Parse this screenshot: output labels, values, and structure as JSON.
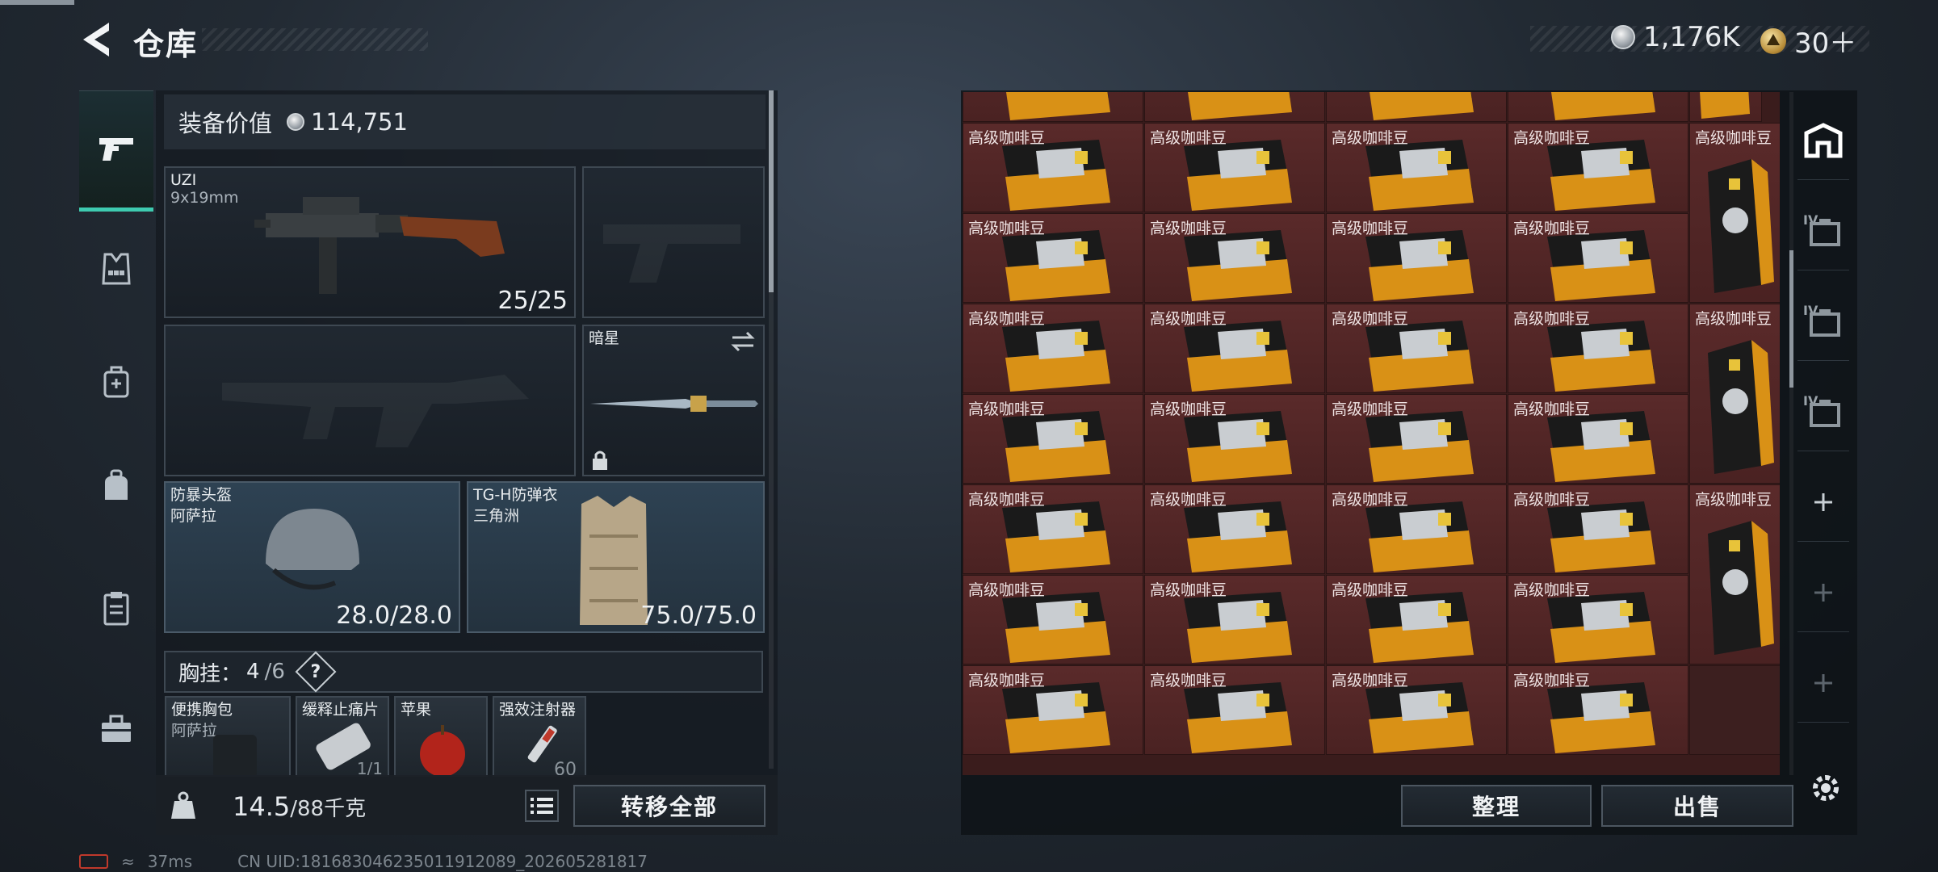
{
  "header": {
    "title": "仓库",
    "currency_silver": "1,176K",
    "currency_gold": "30＋"
  },
  "left_nav": {
    "items": [
      "weapons-icon",
      "armor-icon",
      "backpack-icon",
      "bag-icon",
      "clipboard-icon",
      "toolbox-icon"
    ]
  },
  "equipment": {
    "value_label": "装备价值",
    "value": "114,751",
    "primary_weapon": {
      "name": "UZI",
      "ammo_type": "9x19mm",
      "ammo": "25/25"
    },
    "melee": {
      "name": "暗星"
    },
    "helmet": {
      "name": "防暴头盔",
      "source": "阿萨拉",
      "durability": "28.0/28.0"
    },
    "armor": {
      "name": "TG-H防弹衣",
      "source": "三角洲",
      "durability": "75.0/75.0"
    },
    "chest_rig": {
      "label": "胸挂：",
      "used": "4",
      "capacity": "/6",
      "help": "?"
    },
    "chest_items": [
      {
        "name": "便携胸包",
        "sub": "阿萨拉"
      },
      {
        "name": "缓释止痛片",
        "sub": "1/1"
      },
      {
        "name": "苹果",
        "sub": ""
      },
      {
        "name": "强效注射器",
        "sub": "60"
      }
    ]
  },
  "weight": {
    "current": "14.5",
    "max": "/88千克"
  },
  "actions": {
    "transfer_all": "转移全部",
    "organize": "整理",
    "sell": "出售"
  },
  "stash": {
    "item_label": "高级咖啡豆"
  },
  "side_tabs": [
    {
      "icon": "stash-main-icon",
      "label": ""
    },
    {
      "icon": "case-iv-1-icon",
      "label": "IV"
    },
    {
      "icon": "case-iv-2-icon",
      "label": "IV"
    },
    {
      "icon": "case-iv-3-icon",
      "label": "IV"
    },
    {
      "icon": "add-icon",
      "label": "+"
    },
    {
      "icon": "add-icon",
      "label": "+"
    },
    {
      "icon": "add-icon",
      "label": "+"
    }
  ],
  "status_bar": {
    "ping": "37ms",
    "uid": "CN UID:1816830462350119120​89_202605281817"
  }
}
